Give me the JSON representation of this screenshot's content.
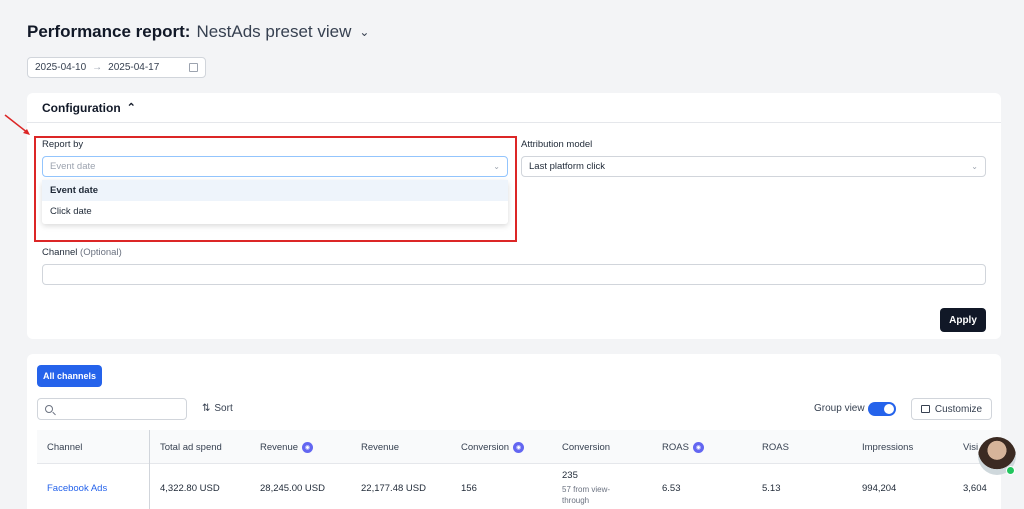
{
  "header": {
    "title_bold": "Performance report:",
    "view_name": "NestAds preset view"
  },
  "date_range": {
    "start": "2025-04-10",
    "end": "2025-04-17"
  },
  "configuration": {
    "title": "Configuration",
    "report_by": {
      "label": "Report by",
      "placeholder": "Event date",
      "options": [
        "Event date",
        "Click date"
      ],
      "highlighted_option": "Event date"
    },
    "attribution_model": {
      "label": "Attribution model",
      "value": "Last platform click"
    },
    "channel": {
      "label": "Channel",
      "optional": "(Optional)",
      "value": ""
    },
    "apply_label": "Apply"
  },
  "results": {
    "tab_label": "All channels",
    "search_placeholder": "",
    "sort_label": "Sort",
    "group_view_label": "Group view",
    "group_view_on": true,
    "customize_label": "Customize",
    "columns": [
      "Channel",
      "Total ad spend",
      "Revenue",
      "Revenue",
      "Conversion",
      "Conversion",
      "ROAS",
      "ROAS",
      "Impressions",
      "Visi"
    ],
    "columns_with_badge": [
      2,
      4,
      6
    ],
    "rows": [
      {
        "channel": "Facebook Ads",
        "total_ad_spend": "4,322.80 USD",
        "revenue_a": "28,245.00 USD",
        "revenue_b": "22,177.48 USD",
        "conversion_a": "156",
        "conversion_b": "235",
        "conversion_b_sub": "57 from view-through",
        "roas_a": "6.53",
        "roas_b": "5.13",
        "impressions": "994,204",
        "visits": "3,604"
      }
    ]
  },
  "colors": {
    "accent": "#2563eb",
    "highlight": "#dc2626",
    "apply": "#111827",
    "badge": "#6366f1"
  }
}
